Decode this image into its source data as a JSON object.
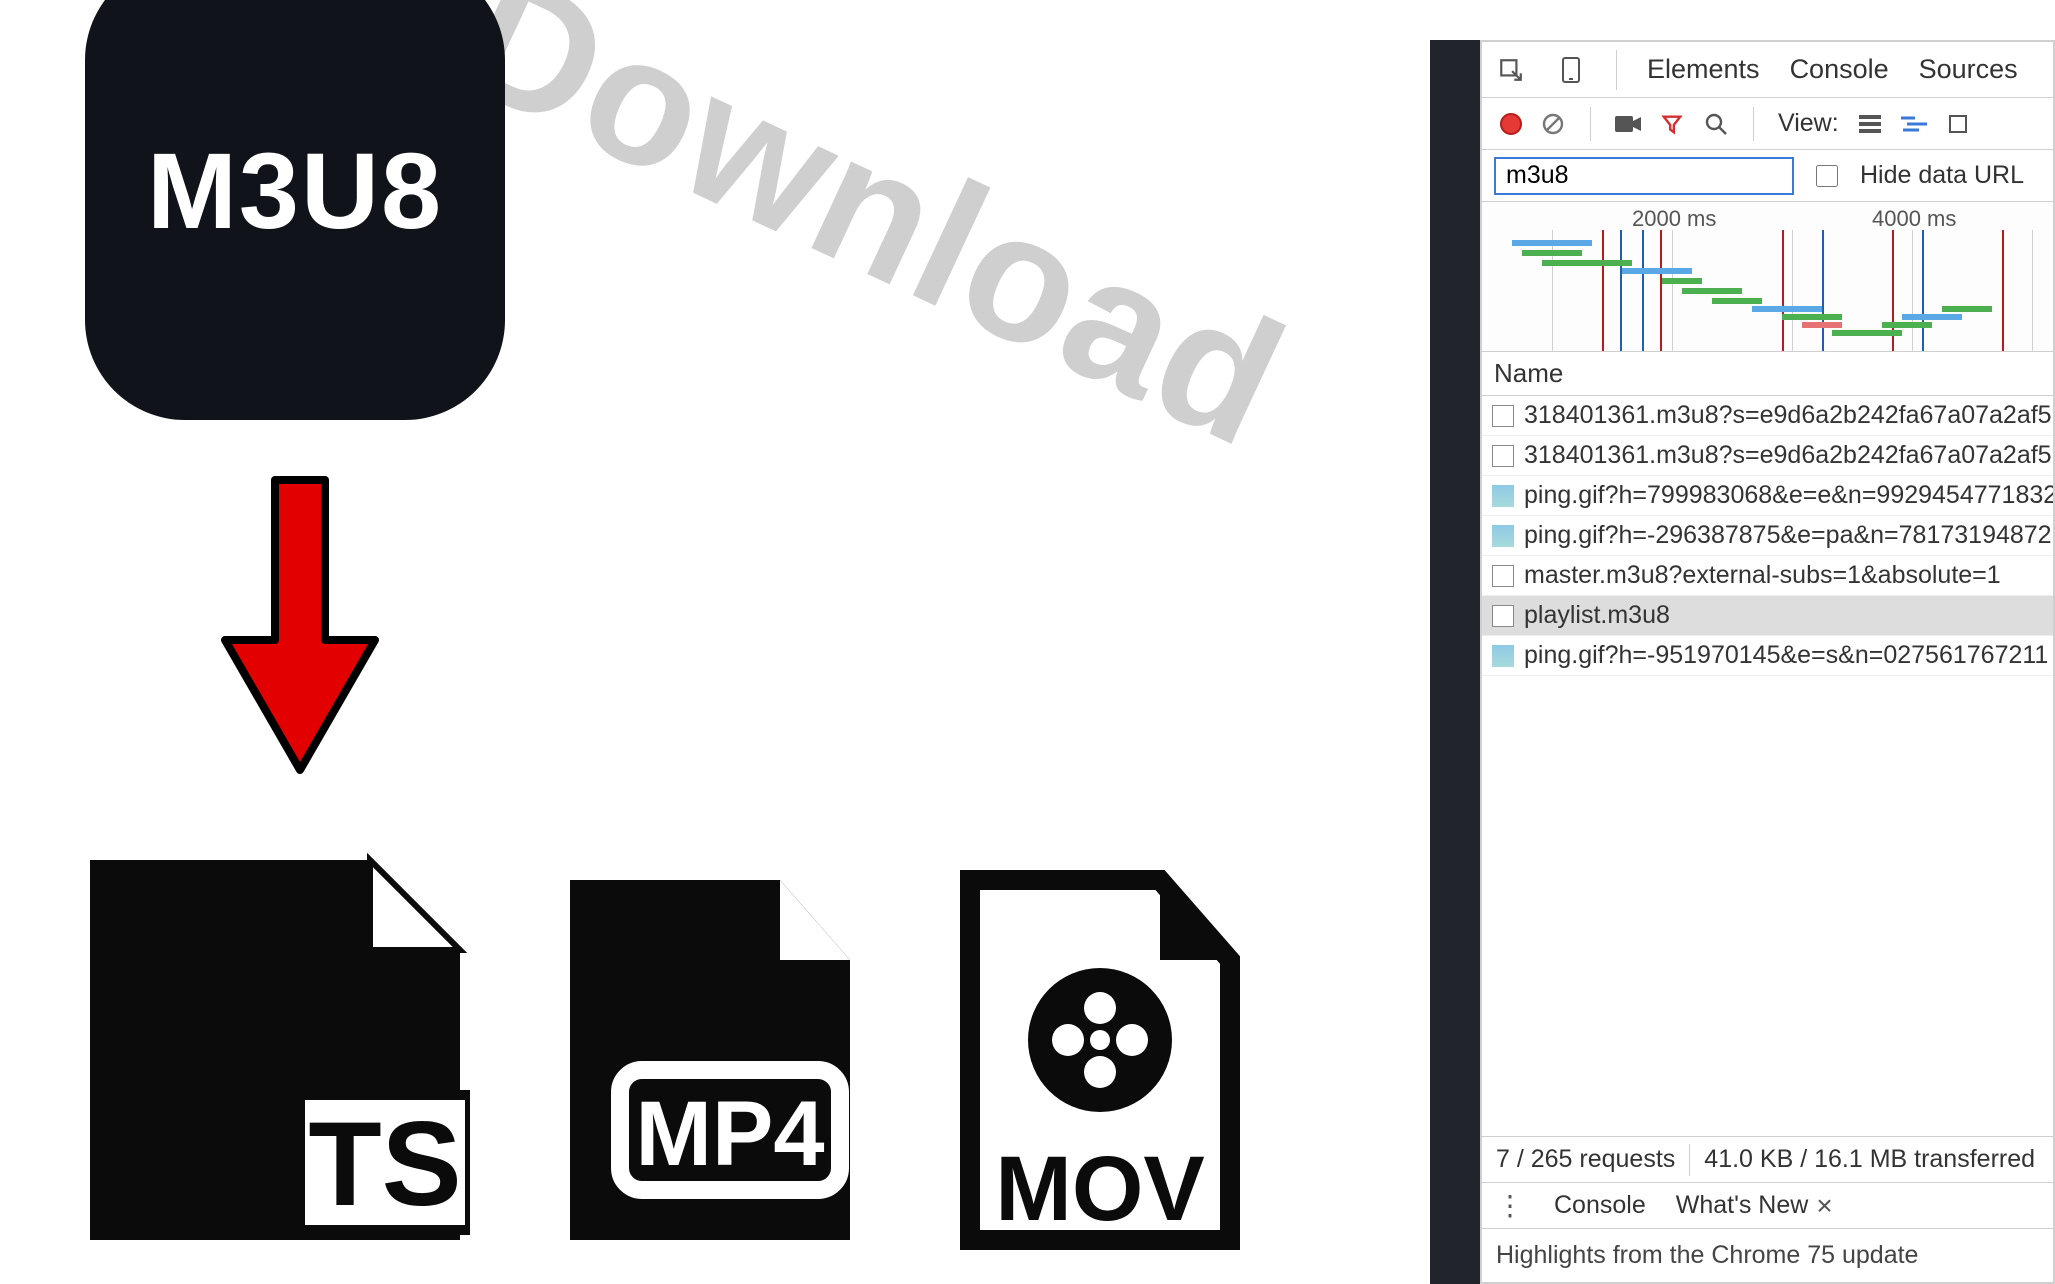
{
  "promo": {
    "download_label": "Download",
    "badge_label": "M3U8",
    "format_ts": "TS",
    "format_mp4": "MP4",
    "format_mov": "MOV"
  },
  "devtools": {
    "tabs": {
      "elements": "Elements",
      "console": "Console",
      "sources": "Sources"
    },
    "toolbar": {
      "view_label": "View:"
    },
    "filter": {
      "value": "m3u8",
      "hide_data_url_label": "Hide data URL"
    },
    "waterfall": {
      "tick_2000": "2000 ms",
      "tick_4000": "4000 ms"
    },
    "column_header": "Name",
    "requests": [
      {
        "icon": "doc",
        "name": "318401361.m3u8?s=e9d6a2b242fa67a07a2af5"
      },
      {
        "icon": "doc",
        "name": "318401361.m3u8?s=e9d6a2b242fa67a07a2af5"
      },
      {
        "icon": "img",
        "name": "ping.gif?h=799983068&e=e&n=9929454771832"
      },
      {
        "icon": "img",
        "name": "ping.gif?h=-296387875&e=pa&n=78173194872"
      },
      {
        "icon": "doc",
        "name": "master.m3u8?external-subs=1&absolute=1"
      },
      {
        "icon": "doc",
        "name": "playlist.m3u8",
        "selected": true
      },
      {
        "icon": "img",
        "name": "ping.gif?h=-951970145&e=s&n=027561767211"
      }
    ],
    "status": {
      "requests": "7 / 265 requests",
      "transferred": "41.0 KB / 16.1 MB transferred"
    },
    "drawer": {
      "tab_console": "Console",
      "tab_whatsnew": "What's New",
      "close_glyph": "×",
      "body": "Highlights from the Chrome 75 update"
    }
  }
}
